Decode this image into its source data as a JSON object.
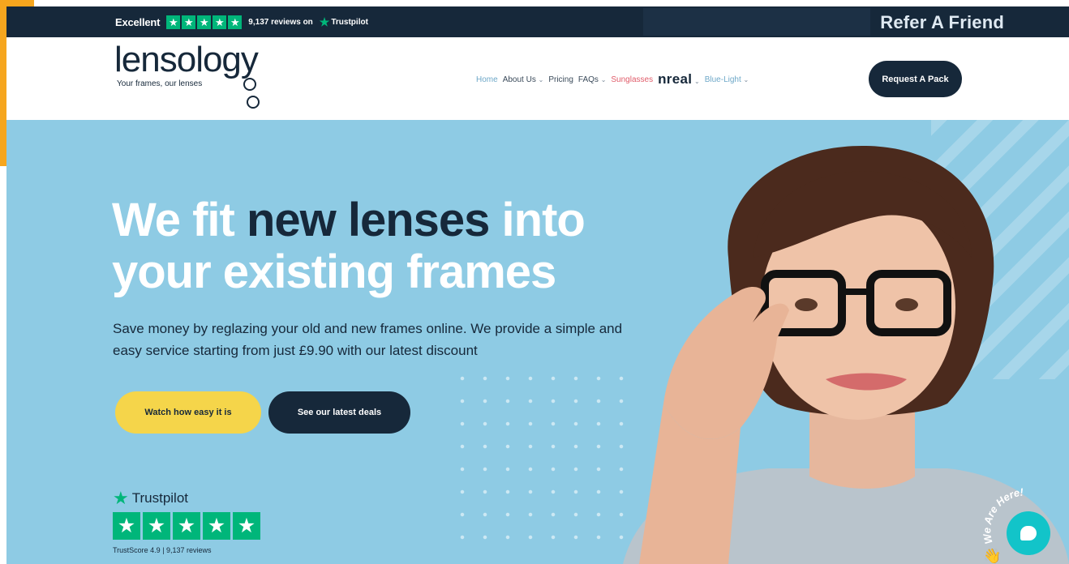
{
  "top_bar": {
    "trustpilot_rating_word": "Excellent",
    "review_text": "9,137 reviews on",
    "trustpilot_brand": "Trustpilot",
    "refer_label": "Refer A Friend"
  },
  "header": {
    "logo_text": "lensology",
    "logo_tagline": "Your frames, our lenses",
    "nav": [
      {
        "label": "Home"
      },
      {
        "label": "About Us"
      },
      {
        "label": "Pricing"
      },
      {
        "label": "FAQs"
      },
      {
        "label": "Sunglasses"
      },
      {
        "label": "nreal"
      },
      {
        "label": "Blue-Light"
      }
    ],
    "request_button": "Request A Pack"
  },
  "hero": {
    "headline_part1": "We fit ",
    "headline_part2": "new lenses",
    "headline_part3": " into",
    "headline_line2": "your existing frames",
    "subtext": "Save money by reglazing your old and new frames online. We provide a simple and easy service starting from just £9.90 with our latest discount",
    "primary_button": "Watch how easy it is",
    "secondary_button": "See our latest deals",
    "trustpilot_brand": "Trustpilot",
    "trust_score": "TrustScore 4.9 | 9,137 reviews"
  },
  "chat_widget": {
    "badge_text": "We Are Here!"
  },
  "colors": {
    "navy": "#16283a",
    "hero_blue": "#8ecbe4",
    "trustpilot_green": "#00b67a",
    "yellow": "#f5d54a",
    "chat_teal": "#12c4c9",
    "orange_tab": "#f6a61e"
  },
  "icons": [
    "trustpilot-star-icon",
    "chevron-down-icon",
    "chat-bubble-icon",
    "waving-hand-icon"
  ]
}
